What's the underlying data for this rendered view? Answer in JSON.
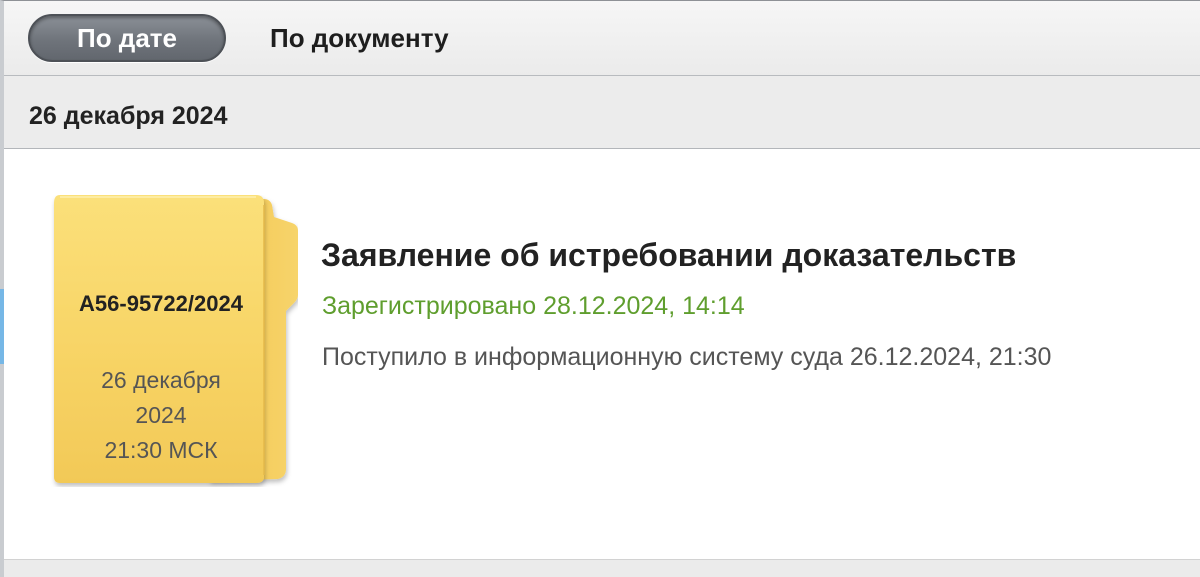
{
  "view_toggle": {
    "by_date_label": "По дате",
    "by_document_label": "По документу"
  },
  "date_group": {
    "title": "26 декабря 2024"
  },
  "document": {
    "case_number": "А56-95722/2024",
    "folder_date_line1": "26 декабря",
    "folder_date_line2": "2024",
    "folder_time": "21:30 МСК",
    "title": "Заявление об истребовании доказательств",
    "registered": "Зарегистрировано 28.12.2024, 14:14",
    "received": "Поступило в информационную систему суда 26.12.2024, 21:30"
  },
  "colors": {
    "folder_yellow": "#f8d567",
    "registered_green": "#5f9e2e",
    "active_toggle_gray": "#6f747b"
  },
  "icons": {
    "folder": "folder-icon"
  }
}
